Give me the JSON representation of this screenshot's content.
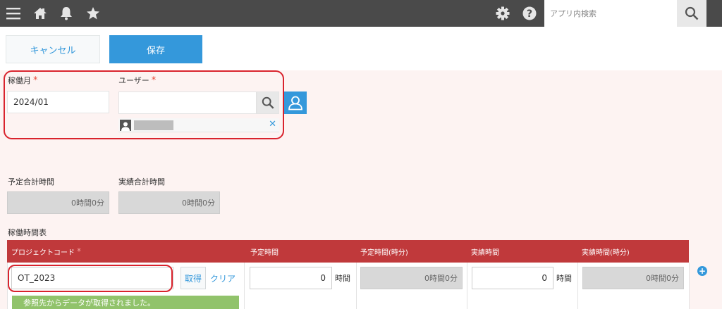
{
  "header": {
    "search_placeholder": "アプリ内検索",
    "icons": [
      "menu-icon",
      "home-icon",
      "bell-icon",
      "star-icon",
      "gear-icon",
      "help-icon",
      "search-icon"
    ]
  },
  "actions": {
    "cancel_label": "キャンセル",
    "save_label": "保存"
  },
  "form": {
    "month": {
      "label": "稼働月",
      "required_mark": "*",
      "value": "2024/01"
    },
    "user": {
      "label": "ユーザー",
      "required_mark": "*",
      "value": "",
      "remove_mark": "✕"
    },
    "planned_total": {
      "label": "予定合計時間",
      "value": "0時間0分"
    },
    "actual_total": {
      "label": "実績合計時間",
      "value": "0時間0分"
    },
    "table_title": "稼働時間表"
  },
  "table": {
    "headers": [
      {
        "label": "プロジェクトコード",
        "required_mark": "*"
      },
      {
        "label": "予定時間"
      },
      {
        "label": "予定時間(時分)"
      },
      {
        "label": "実績時間"
      },
      {
        "label": "実績時間(時分)"
      }
    ],
    "rows": [
      {
        "project_code": "OT_2023",
        "get_label": "取得",
        "clear_label": "クリア",
        "planned_hours": "0",
        "planned_unit": "時間",
        "planned_hm": "0時間0分",
        "actual_hours": "0",
        "actual_unit": "時間",
        "actual_hm": "0時間0分",
        "message": "参照先からデータが取得されました。"
      }
    ],
    "add_row_mark": "+"
  },
  "colors": {
    "topbar": "#4a4a4a",
    "accent": "#3498db",
    "table_header": "#c0393b",
    "highlight": "#d9232d",
    "success": "#91c36b",
    "form_bg": "#fdf3f2"
  }
}
